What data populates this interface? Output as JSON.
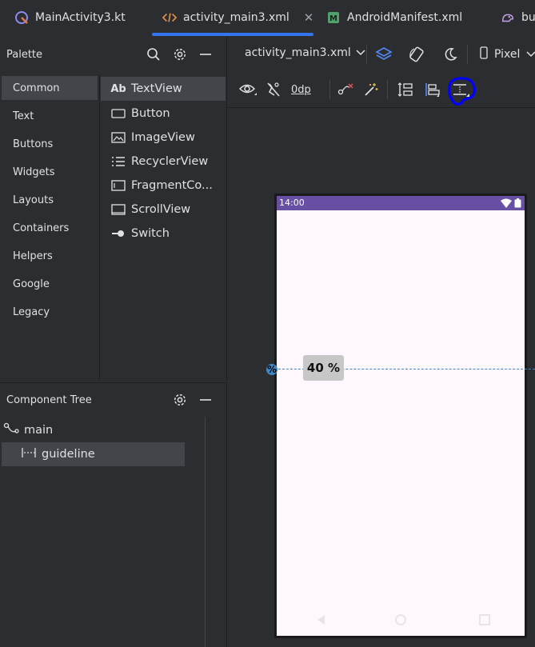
{
  "tabs": [
    {
      "label": "MainActivity3.kt",
      "icon": "kotlin-file-icon"
    },
    {
      "label": "activity_main3.xml",
      "icon": "xml-file-icon",
      "active": true
    },
    {
      "label": "AndroidManifest.xml",
      "icon": "manifest-file-icon"
    },
    {
      "label": "bu",
      "icon": "gradle-file-icon"
    }
  ],
  "palette": {
    "title": "Palette",
    "categories": [
      "Common",
      "Text",
      "Buttons",
      "Widgets",
      "Layouts",
      "Containers",
      "Helpers",
      "Google",
      "Legacy"
    ],
    "selected_category": "Common",
    "widgets": [
      {
        "label": "TextView",
        "icon": "textview-icon",
        "glyph": "Ab"
      },
      {
        "label": "Button",
        "icon": "button-icon"
      },
      {
        "label": "ImageView",
        "icon": "imageview-icon"
      },
      {
        "label": "RecyclerView",
        "icon": "recyclerview-icon"
      },
      {
        "label": "FragmentCo...",
        "icon": "fragment-icon"
      },
      {
        "label": "ScrollView",
        "icon": "scrollview-icon"
      },
      {
        "label": "Switch",
        "icon": "switch-icon"
      }
    ]
  },
  "component_tree": {
    "title": "Component Tree",
    "items": [
      {
        "label": "main",
        "icon": "constraint-layout-icon"
      },
      {
        "label": "guideline",
        "icon": "guideline-icon",
        "selected": true
      }
    ]
  },
  "editor": {
    "file_dropdown": "activity_main3.xml",
    "device_dropdown": "Pixel",
    "default_margin": "0dp"
  },
  "device": {
    "status_time": "14:00"
  },
  "guideline": {
    "handle_symbol": "%",
    "percent_label": "40 %",
    "percent": 0.4
  },
  "colors": {
    "accent": "#3574f0",
    "status_bar": "#6750a4",
    "screen_bg": "#fff7fe",
    "guideline": "#3f88c5",
    "annotation": "#0000ff"
  }
}
